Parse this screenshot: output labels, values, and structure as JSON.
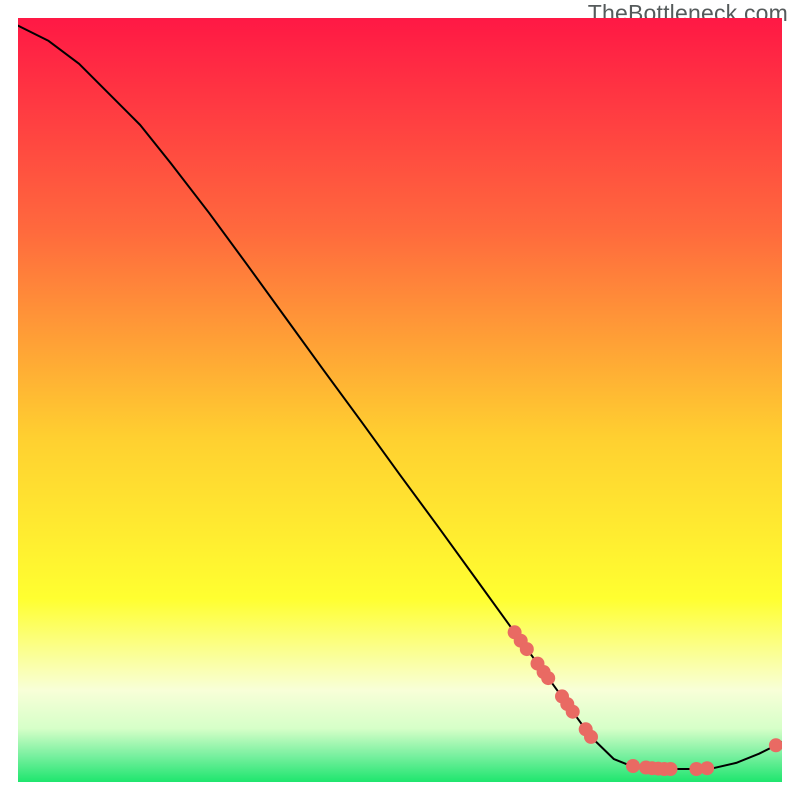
{
  "watermark": "TheBottleneck.com",
  "palette": {
    "gradient_top": "#ff1845",
    "gradient_mid1": "#ff8040",
    "gradient_mid2": "#ffd030",
    "gradient_mid3": "#ffff30",
    "gradient_bottom_pale": "#f8ffd8",
    "gradient_green": "#1ee66e",
    "curve_stroke": "#000000",
    "point_fill": "#e96a63"
  },
  "chart_data": {
    "type": "line",
    "title": "",
    "xlabel": "",
    "ylabel": "",
    "xlim": [
      0,
      100
    ],
    "ylim": [
      0,
      100
    ],
    "curve": [
      {
        "x": 0,
        "y": 99
      },
      {
        "x": 4,
        "y": 97
      },
      {
        "x": 8,
        "y": 94
      },
      {
        "x": 12,
        "y": 90
      },
      {
        "x": 16,
        "y": 86
      },
      {
        "x": 20,
        "y": 81
      },
      {
        "x": 25,
        "y": 74.5
      },
      {
        "x": 30,
        "y": 67.7
      },
      {
        "x": 35,
        "y": 60.8
      },
      {
        "x": 40,
        "y": 53.9
      },
      {
        "x": 45,
        "y": 47.1
      },
      {
        "x": 50,
        "y": 40.2
      },
      {
        "x": 55,
        "y": 33.4
      },
      {
        "x": 60,
        "y": 26.5
      },
      {
        "x": 65,
        "y": 19.6
      },
      {
        "x": 70,
        "y": 12.8
      },
      {
        "x": 75,
        "y": 5.9
      },
      {
        "x": 78,
        "y": 3.0
      },
      {
        "x": 80,
        "y": 2.2
      },
      {
        "x": 82,
        "y": 1.8
      },
      {
        "x": 85,
        "y": 1.7
      },
      {
        "x": 88,
        "y": 1.7
      },
      {
        "x": 91,
        "y": 1.8
      },
      {
        "x": 94,
        "y": 2.5
      },
      {
        "x": 97,
        "y": 3.7
      },
      {
        "x": 100,
        "y": 5.2
      }
    ],
    "points": [
      {
        "x": 65,
        "y": 19.6
      },
      {
        "x": 65.8,
        "y": 18.5
      },
      {
        "x": 66.6,
        "y": 17.4
      },
      {
        "x": 68,
        "y": 15.5
      },
      {
        "x": 68.8,
        "y": 14.4
      },
      {
        "x": 69.4,
        "y": 13.6
      },
      {
        "x": 71.2,
        "y": 11.2
      },
      {
        "x": 71.9,
        "y": 10.2
      },
      {
        "x": 72.6,
        "y": 9.2
      },
      {
        "x": 74.3,
        "y": 6.9
      },
      {
        "x": 75.0,
        "y": 5.9
      },
      {
        "x": 80.5,
        "y": 2.1
      },
      {
        "x": 82.2,
        "y": 1.9
      },
      {
        "x": 83,
        "y": 1.8
      },
      {
        "x": 83.8,
        "y": 1.75
      },
      {
        "x": 84.6,
        "y": 1.7
      },
      {
        "x": 85.4,
        "y": 1.7
      },
      {
        "x": 88.8,
        "y": 1.7
      },
      {
        "x": 90.2,
        "y": 1.8
      },
      {
        "x": 99.2,
        "y": 4.8
      }
    ]
  }
}
